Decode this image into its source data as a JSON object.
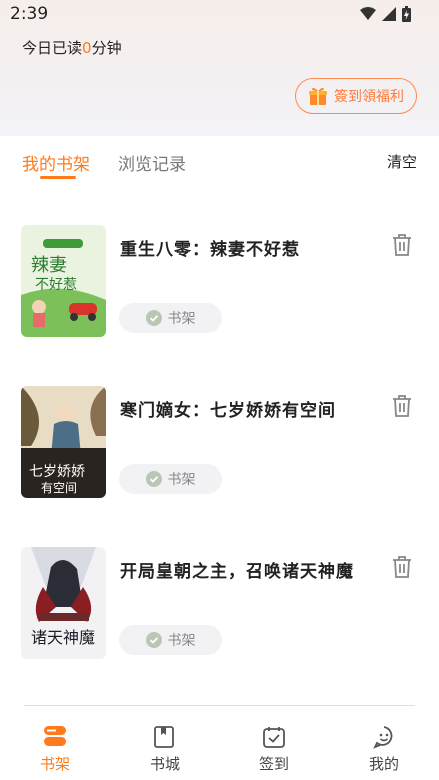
{
  "status": {
    "time": "2:39"
  },
  "header": {
    "read_prefix": "今日已读",
    "read_minutes": "0",
    "read_suffix": "分钟",
    "signin_label": "簽到領福利"
  },
  "tabs": {
    "shelf": "我的书架",
    "history": "浏览记录",
    "clear": "清空"
  },
  "books": [
    {
      "title": "重生八零：辣妻不好惹",
      "shelf_label": "书架",
      "cover_text": "辣妻不好惹"
    },
    {
      "title": "寒门嫡女：七岁娇娇有空间",
      "shelf_label": "书架",
      "cover_text": "七岁娇娇有空间"
    },
    {
      "title": "开局皇朝之主，召唤诸天神魔",
      "shelf_label": "书架",
      "cover_text": "诸天神魔"
    }
  ],
  "nav": [
    {
      "label": "书架"
    },
    {
      "label": "书城"
    },
    {
      "label": "签到"
    },
    {
      "label": "我的"
    }
  ],
  "colors": {
    "accent": "#ff7a1a",
    "signin": "#ff8a50"
  }
}
